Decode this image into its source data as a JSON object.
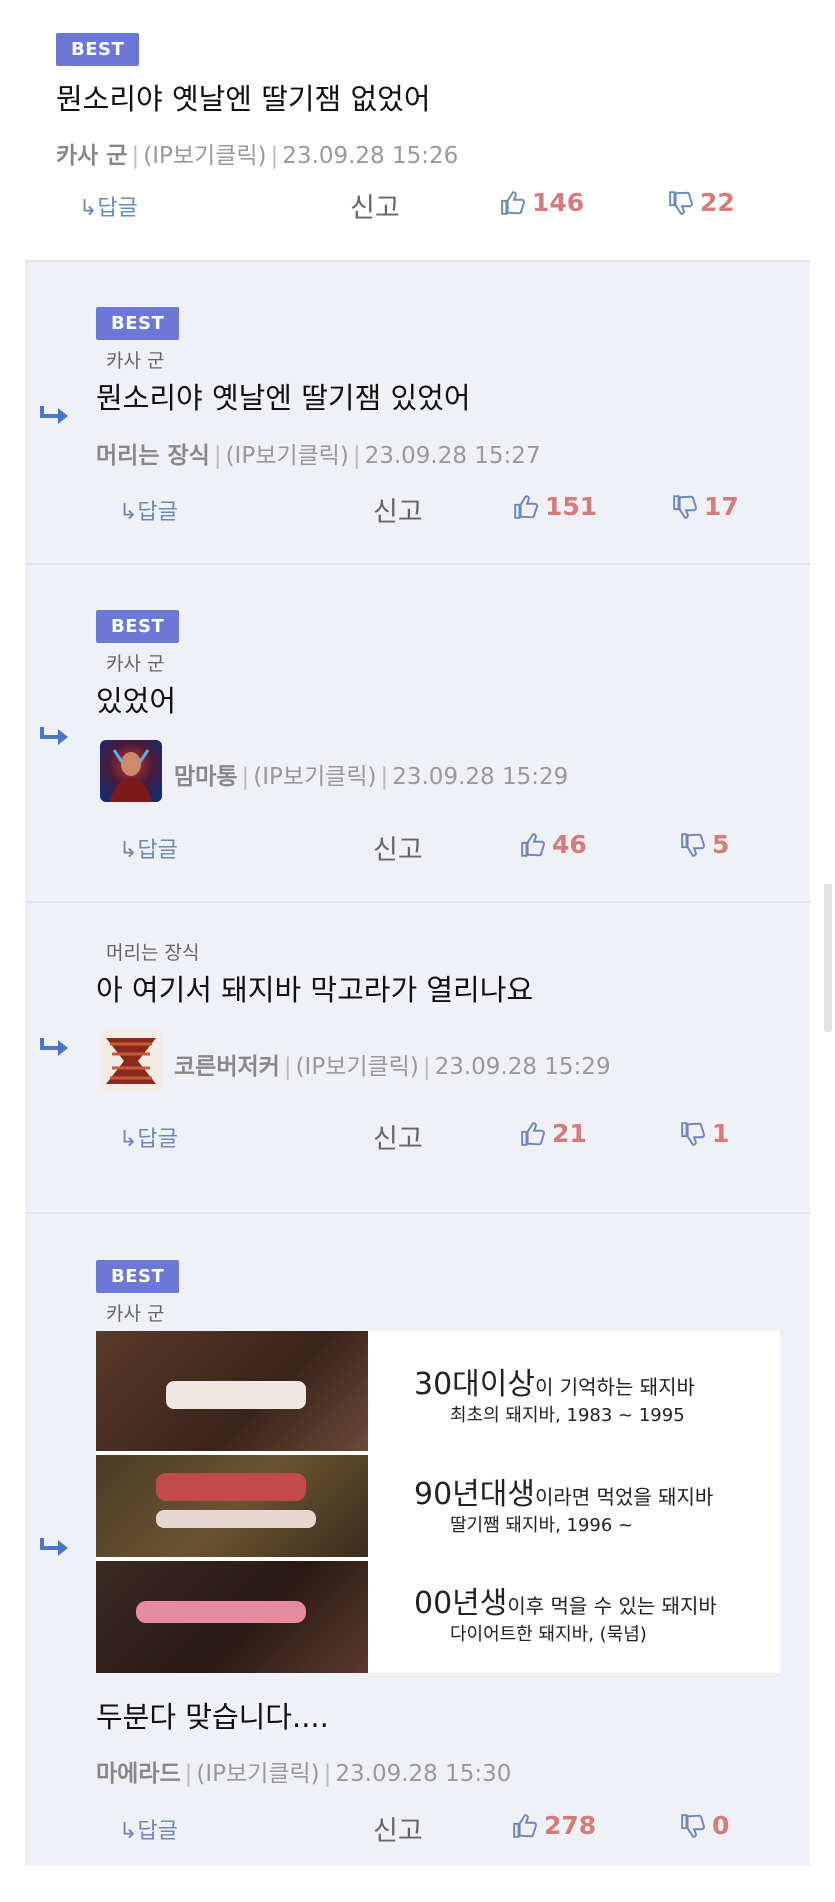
{
  "colors": {
    "badge": "#6b78d6",
    "reply_bg": "#eff1f6",
    "vote": "#d67a7a",
    "reply_link": "#6a89b8"
  },
  "labels": {
    "best": "BEST",
    "reply": "↳답글",
    "report": "신고",
    "ip": "(IP보기클릭)"
  },
  "comments": [
    {
      "best": true,
      "parent_nick": "",
      "text": "뭔소리야 옛날엔 딸기잼 없었어",
      "nick": "카사 군",
      "date": "23.09.28 15:26",
      "likes": "146",
      "dislikes": "22"
    },
    {
      "best": true,
      "parent_nick": "카사 군",
      "text": "뭔소리야 옛날엔 딸기잼 있었어",
      "nick": "머리는 장식",
      "date": "23.09.28 15:27",
      "likes": "151",
      "dislikes": "17"
    },
    {
      "best": true,
      "parent_nick": "카사 군",
      "text": "있었어",
      "nick": "맘마통",
      "date": "23.09.28 15:29",
      "likes": "46",
      "dislikes": "5",
      "avatar": "avatar-portrait"
    },
    {
      "best": false,
      "parent_nick": "머리는 장식",
      "text": "아 여기서 돼지바 막고라가 열리나요",
      "nick": "코른버저커",
      "date": "23.09.28 15:29",
      "likes": "21",
      "dislikes": "1",
      "avatar": "avatar-emblem"
    },
    {
      "best": true,
      "parent_nick": "카사 군",
      "text": "두분다 맞습니다....",
      "nick": "마에라드",
      "date": "23.09.28 15:30",
      "likes": "278",
      "dislikes": "0",
      "image": {
        "rows": [
          {
            "big": "30대이상",
            "small": "이 기억하는 돼지바",
            "sub": "최초의 돼지바, 1983 ~ 1995"
          },
          {
            "big": "90년대생",
            "small": "이라면 먹었을 돼지바",
            "sub": "딸기쨈 돼지바, 1996 ~"
          },
          {
            "big": "00년생",
            "small": "이후 먹을 수 있는 돼지바",
            "sub": "다이어트한 돼지바, (묵념)"
          }
        ]
      }
    }
  ]
}
